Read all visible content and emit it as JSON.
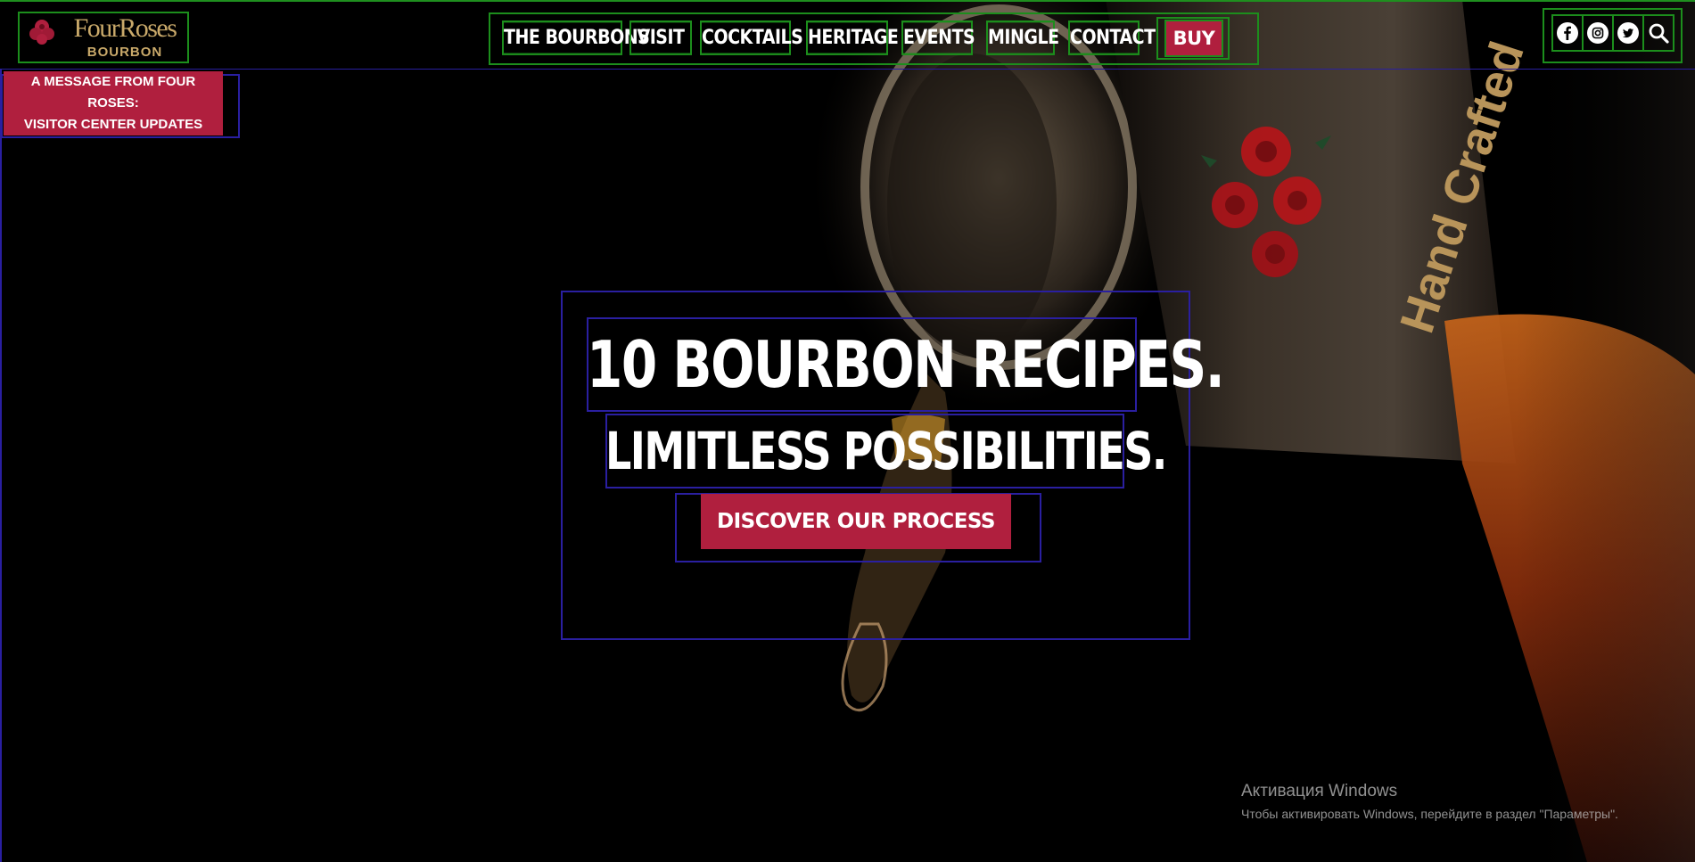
{
  "header": {
    "logo": {
      "brand": "FourRoses",
      "sub": "BOURBON"
    },
    "nav": [
      {
        "label": "THE BOURBONS"
      },
      {
        "label": "VISIT"
      },
      {
        "label": "COCKTAILS"
      },
      {
        "label": "HERITAGE"
      },
      {
        "label": "EVENTS"
      },
      {
        "label": "MINGLE"
      },
      {
        "label": "CONTACT"
      },
      {
        "label": "BUY"
      }
    ],
    "social": [
      {
        "icon": "facebook-icon"
      },
      {
        "icon": "instagram-icon"
      },
      {
        "icon": "twitter-icon"
      },
      {
        "icon": "search-icon"
      }
    ]
  },
  "message": {
    "line1": "A MESSAGE FROM FOUR ROSES:",
    "line2": "VISITOR CENTER UPDATES"
  },
  "hero": {
    "headline": "10 BOURBON RECIPES.",
    "subline": "LIMITLESS POSSIBILITIES.",
    "cta_label": "DISCOVER OUR PROCESS",
    "bottle_text": "Hand Crafted"
  },
  "watermark": {
    "title": "Активация Windows",
    "text": "Чтобы активировать Windows, перейдите в раздел \"Параметры\"."
  },
  "colors": {
    "accent": "#b01f3e",
    "logo_gold": "#c9a96a",
    "background": "#000000"
  }
}
